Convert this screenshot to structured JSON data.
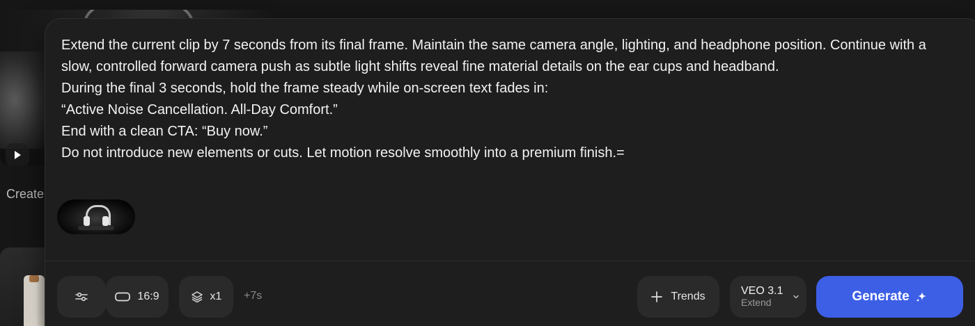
{
  "background": {
    "caption": "Create",
    "play_icon": "play-icon"
  },
  "prompt": {
    "text": "Extend the current clip by 7 seconds from its final frame. Maintain the same camera angle, lighting, and headphone position. Continue with a slow, controlled forward camera push as subtle light shifts reveal fine material details on the ear cups and headband.\nDuring the final 3 seconds, hold the frame steady while on-screen text fades in:\n“Active Noise Cancellation. All-Day Comfort.”\nEnd with a clean CTA: “Buy now.”\nDo not introduce new elements or cuts. Let motion resolve smoothly into a premium finish.="
  },
  "toolbar": {
    "settings_icon": "sliders-icon",
    "aspect_ratio": "16:9",
    "aspect_icon": "rectangle-icon",
    "count": "x1",
    "count_icon": "layers-icon",
    "duration": "+7s",
    "trends_label": "Trends",
    "trends_icon": "plus-icon",
    "model_name": "VEO 3.1",
    "model_mode": "Extend",
    "model_icon": "chevron-down-icon",
    "generate_label": "Generate",
    "generate_icon": "sparkle-icon"
  },
  "colors": {
    "accent": "#3d5fe6",
    "panel": "#1e1e1e",
    "chip": "#2a2a2a"
  }
}
